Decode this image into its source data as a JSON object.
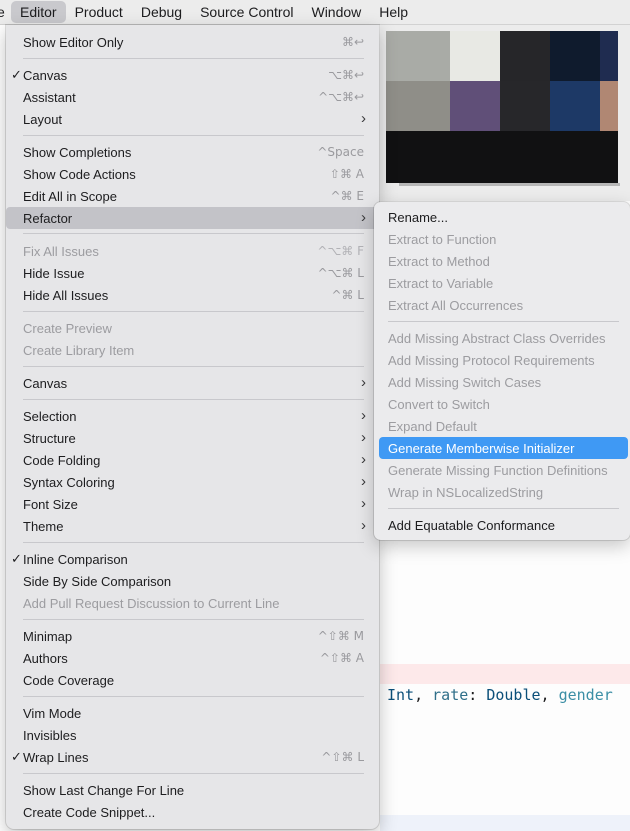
{
  "menubar": {
    "items": [
      {
        "label": "e"
      },
      {
        "label": "Editor"
      },
      {
        "label": "Product"
      },
      {
        "label": "Debug"
      },
      {
        "label": "Source Control"
      },
      {
        "label": "Window"
      },
      {
        "label": "Help"
      }
    ]
  },
  "editor_menu": {
    "items": [
      {
        "label": "Show Editor Only",
        "shortcut": "⌘↩"
      },
      {
        "label": "Canvas",
        "shortcut": "⌥⌘↩",
        "checked": "✓"
      },
      {
        "label": "Assistant",
        "shortcut": "^⌥⌘↩"
      },
      {
        "label": "Layout",
        "arrow": "›"
      },
      {
        "label": "Show Completions",
        "shortcut": "^Space"
      },
      {
        "label": "Show Code Actions",
        "shortcut": "⇧⌘ A"
      },
      {
        "label": "Edit All in Scope",
        "shortcut": "^⌘ E"
      },
      {
        "label": "Refactor",
        "arrow": "›"
      },
      {
        "label": "Fix All Issues",
        "shortcut": "^⌥⌘ F"
      },
      {
        "label": "Hide Issue",
        "shortcut": "^⌥⌘ L"
      },
      {
        "label": "Hide All Issues",
        "shortcut": "^⌘ L"
      },
      {
        "label": "Create Preview"
      },
      {
        "label": "Create Library Item"
      },
      {
        "label": "Canvas",
        "arrow": "›"
      },
      {
        "label": "Selection",
        "arrow": "›"
      },
      {
        "label": "Structure",
        "arrow": "›"
      },
      {
        "label": "Code Folding",
        "arrow": "›"
      },
      {
        "label": "Syntax Coloring",
        "arrow": "›"
      },
      {
        "label": "Font Size",
        "arrow": "›"
      },
      {
        "label": "Theme",
        "arrow": "›"
      },
      {
        "label": "Inline Comparison",
        "checked": "✓"
      },
      {
        "label": "Side By Side Comparison"
      },
      {
        "label": "Add Pull Request Discussion to Current Line"
      },
      {
        "label": "Minimap",
        "shortcut": "^⇧⌘ M"
      },
      {
        "label": "Authors",
        "shortcut": "^⇧⌘ A"
      },
      {
        "label": "Code Coverage"
      },
      {
        "label": "Vim Mode"
      },
      {
        "label": "Invisibles"
      },
      {
        "label": "Wrap Lines",
        "shortcut": "^⇧⌘ L",
        "checked": "✓"
      },
      {
        "label": "Show Last Change For Line"
      },
      {
        "label": "Create Code Snippet..."
      }
    ]
  },
  "refactor_menu": {
    "items": [
      {
        "label": "Rename..."
      },
      {
        "label": "Extract to Function"
      },
      {
        "label": "Extract to Method"
      },
      {
        "label": "Extract to Variable"
      },
      {
        "label": "Extract All Occurrences"
      },
      {
        "label": "Add Missing Abstract Class Overrides"
      },
      {
        "label": "Add Missing Protocol Requirements"
      },
      {
        "label": "Add Missing Switch Cases"
      },
      {
        "label": "Convert to Switch"
      },
      {
        "label": "Expand Default"
      },
      {
        "label": "Generate Memberwise Initializer"
      },
      {
        "label": "Generate Missing Function Definitions"
      },
      {
        "label": "Wrap in NSLocalizedString"
      },
      {
        "label": "Add Equatable Conformance"
      }
    ]
  },
  "code": {
    "t1": "Int",
    "s1": ", ",
    "p1": "rate",
    "s2": ": ",
    "t2": "Double",
    "s3": ", ",
    "p2": "gender"
  },
  "colors": {
    "selection": "#3f99f4",
    "menu_highlight": "#c3c3c8",
    "disabled_text": "#9c9ca0"
  }
}
